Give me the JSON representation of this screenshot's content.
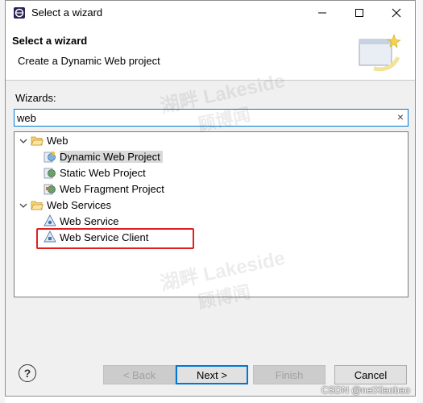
{
  "window": {
    "title": "Select a wizard"
  },
  "banner": {
    "title": "Select a wizard",
    "description": "Create a Dynamic Web project"
  },
  "wizards": {
    "label": "Wizards:",
    "filter_value": "web",
    "clear_glyph": "×"
  },
  "tree": {
    "web_category": "Web",
    "web_items": [
      "Dynamic Web Project",
      "Static Web Project",
      "Web Fragment Project"
    ],
    "services_category": "Web Services",
    "services_items": [
      "Web Service",
      "Web Service Client"
    ],
    "selected": "Dynamic Web Project",
    "highlighted": "Web Service Client",
    "highlight_color": "#e02020"
  },
  "buttons": {
    "help": "?",
    "back": "< Back",
    "next": "Next >",
    "finish": "Finish",
    "cancel": "Cancel"
  },
  "watermark": {
    "line1": "湖畔 Lakeside",
    "line2": "顾博闻"
  },
  "credit": "CSDN @netXiaobao",
  "colors": {
    "focus": "#0078d7",
    "selection": "#d9d9d9",
    "folder": "#e8b84a"
  }
}
